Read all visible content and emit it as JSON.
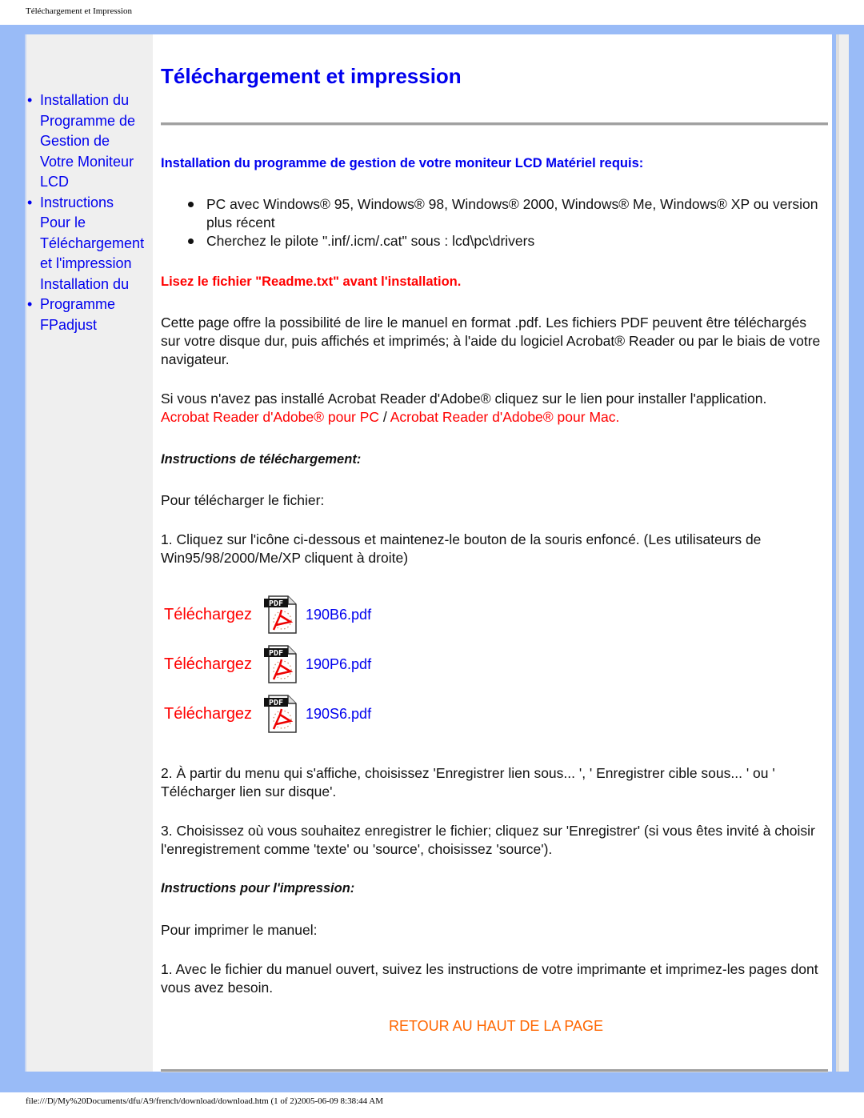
{
  "print_header": "Téléchargement et Impression",
  "print_footer": "file:///D|/My%20Documents/dfu/A9/french/download/download.htm (1 of 2)2005-06-09 8:38:44 AM",
  "colors": {
    "frame": "#99bbf7",
    "sidebar": "#efefef",
    "link_blue": "#0000ee",
    "accent_red": "#ff0000",
    "back_to_top_orange": "#ff6600"
  },
  "sidebar": {
    "items": [
      {
        "bullet": "•",
        "lines": [
          "Installation du",
          "Programme de",
          "Gestion de",
          "Votre Moniteur",
          "LCD"
        ]
      },
      {
        "bullet": "•",
        "lines": [
          "Instructions",
          "Pour le",
          "Téléchargement",
          "et l'impression",
          "Installation du"
        ]
      },
      {
        "bullet": "•",
        "lines": [
          "Programme",
          "FPadjust"
        ]
      }
    ]
  },
  "main": {
    "title": "Téléchargement et impression",
    "install_heading": "Installation du programme de gestion de votre moniteur LCD Matériel requis:",
    "requirements": [
      "PC avec Windows® 95, Windows® 98, Windows® 2000, Windows® Me, Windows® XP ou version plus récent",
      "Cherchez le pilote \".inf/.icm/.cat\" sous : lcd\\pc\\drivers"
    ],
    "readme_notice": "Lisez le fichier \"Readme.txt\" avant l'installation.",
    "intro_paragraph": "Cette page offre la possibilité de lire le manuel en format .pdf. Les fichiers PDF peuvent être téléchargés sur votre disque dur, puis affichés et imprimés; à l'aide du logiciel Acrobat® Reader ou par le biais de votre navigateur.",
    "acrobat_paragraph": "Si vous n'avez pas installé Acrobat Reader d'Adobe® cliquez sur le lien pour installer l'application.",
    "acrobat_pc_link": "Acrobat Reader d'Adobe® pour PC",
    "acrobat_separator": " / ",
    "acrobat_mac_link": "Acrobat Reader d'Adobe® pour Mac.",
    "download_heading": "Instructions de téléchargement:",
    "download_intro": "Pour télécharger le fichier:",
    "download_step1": "1. Cliquez sur l'icône ci-dessous et maintenez-le bouton de la souris enfoncé. (Les utilisateurs de Win95/98/2000/Me/XP cliquent à droite)",
    "downloads": [
      {
        "label": "Téléchargez",
        "icon": "pdf-file-icon",
        "file": "190B6.pdf"
      },
      {
        "label": "Téléchargez",
        "icon": "pdf-file-icon",
        "file": "190P6.pdf"
      },
      {
        "label": "Téléchargez",
        "icon": "pdf-file-icon",
        "file": "190S6.pdf"
      }
    ],
    "download_step2": "2. À partir du menu qui s'affiche, choisissez 'Enregistrer lien sous... ', ' Enregistrer cible sous... ' ou ' Télécharger lien sur disque'.",
    "download_step3": "3. Choisissez où vous souhaitez enregistrer le fichier; cliquez sur 'Enregistrer' (si vous êtes invité à choisir l'enregistrement comme 'texte' ou 'source', choisissez 'source').",
    "print_heading": "Instructions pour l'impression:",
    "print_intro": "Pour imprimer le manuel:",
    "print_step1": "1. Avec le fichier du manuel ouvert, suivez les instructions de votre imprimante et imprimez-les pages dont vous avez besoin.",
    "back_to_top": "RETOUR AU HAUT DE LA PAGE"
  }
}
